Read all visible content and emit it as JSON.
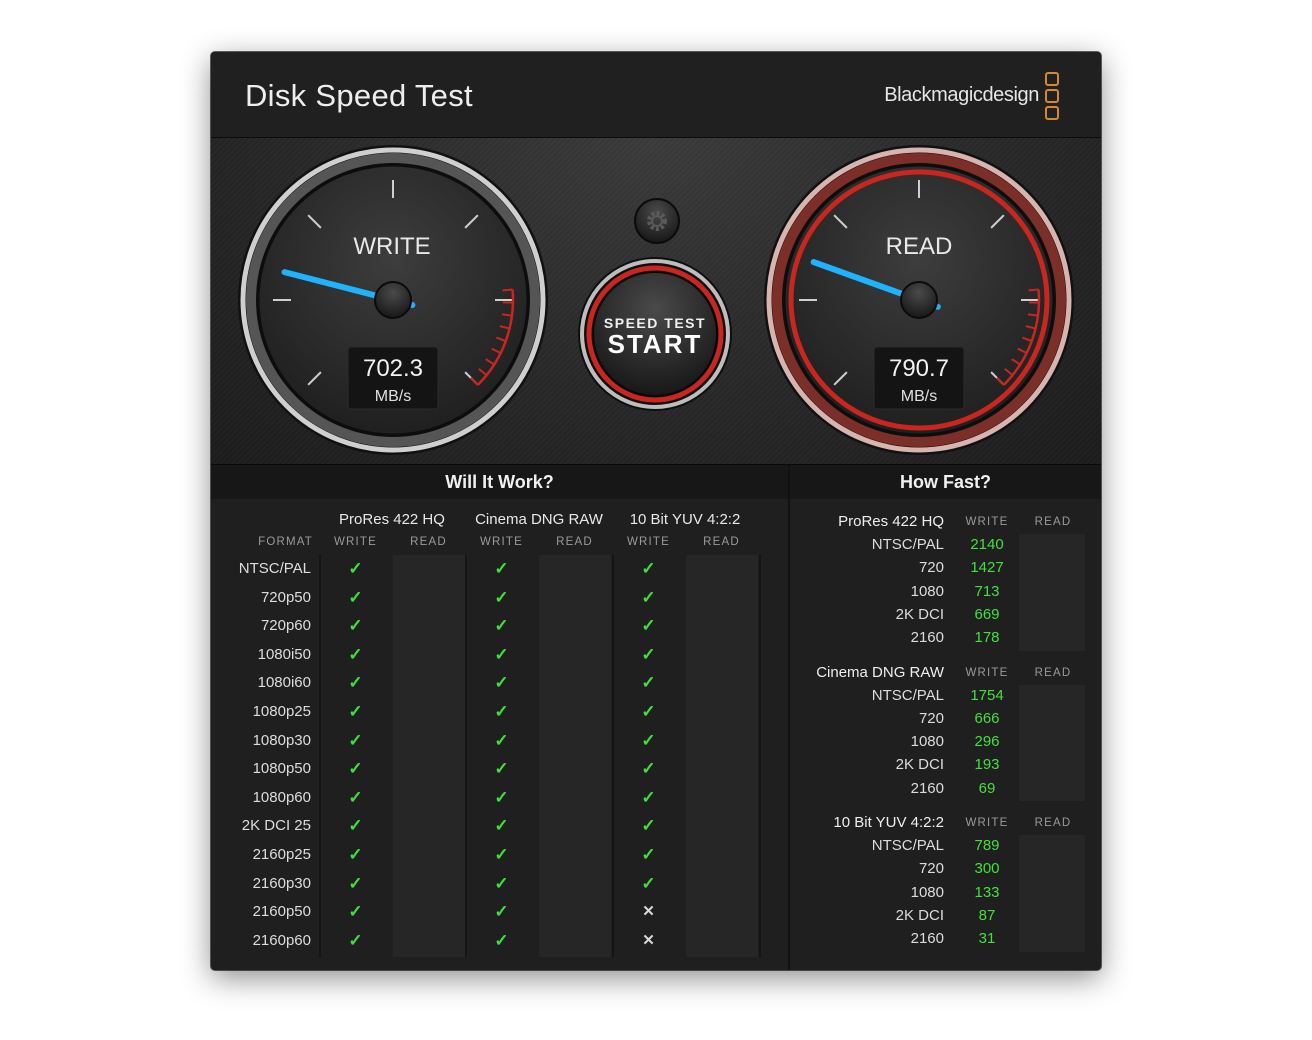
{
  "window": {
    "title": "Disk Speed Test",
    "brand": "Blackmagicdesign",
    "close_glyph": "×"
  },
  "gauges": {
    "write": {
      "label": "WRITE",
      "value": "702.3",
      "unit": "MB/s",
      "needle_fraction": 0.22
    },
    "read": {
      "label": "READ",
      "value": "790.7",
      "unit": "MB/s",
      "needle_fraction": 0.24
    }
  },
  "start_button": {
    "line1": "SPEED TEST",
    "line2": "START"
  },
  "settings_icon": "gear-icon",
  "colors": {
    "accent_red": "#c8261e",
    "needle_blue": "#1fb3ff",
    "ok_green": "#3fe03a",
    "brand_orange": "#d48a2a"
  },
  "will_it_work": {
    "title": "Will It Work?",
    "format_label": "FORMAT",
    "write_label": "WRITE",
    "read_label": "READ",
    "codecs": [
      "ProRes 422 HQ",
      "Cinema DNG RAW",
      "10 Bit YUV 4:2:2"
    ],
    "rows": [
      {
        "format": "NTSC/PAL",
        "write": [
          "ok",
          "ok",
          "ok"
        ]
      },
      {
        "format": "720p50",
        "write": [
          "ok",
          "ok",
          "ok"
        ]
      },
      {
        "format": "720p60",
        "write": [
          "ok",
          "ok",
          "ok"
        ]
      },
      {
        "format": "1080i50",
        "write": [
          "ok",
          "ok",
          "ok"
        ]
      },
      {
        "format": "1080i60",
        "write": [
          "ok",
          "ok",
          "ok"
        ]
      },
      {
        "format": "1080p25",
        "write": [
          "ok",
          "ok",
          "ok"
        ]
      },
      {
        "format": "1080p30",
        "write": [
          "ok",
          "ok",
          "ok"
        ]
      },
      {
        "format": "1080p50",
        "write": [
          "ok",
          "ok",
          "ok"
        ]
      },
      {
        "format": "1080p60",
        "write": [
          "ok",
          "ok",
          "ok"
        ]
      },
      {
        "format": "2K DCI 25",
        "write": [
          "ok",
          "ok",
          "ok"
        ]
      },
      {
        "format": "2160p25",
        "write": [
          "ok",
          "ok",
          "ok"
        ]
      },
      {
        "format": "2160p30",
        "write": [
          "ok",
          "ok",
          "ok"
        ]
      },
      {
        "format": "2160p50",
        "write": [
          "ok",
          "ok",
          "no"
        ]
      },
      {
        "format": "2160p60",
        "write": [
          "ok",
          "ok",
          "no"
        ]
      }
    ],
    "ok_glyph": "✓",
    "no_glyph": "✕"
  },
  "how_fast": {
    "title": "How Fast?",
    "write_label": "WRITE",
    "read_label": "READ",
    "groups": [
      {
        "codec": "ProRes 422 HQ",
        "rows": [
          {
            "label": "NTSC/PAL",
            "write": "2140"
          },
          {
            "label": "720",
            "write": "1427"
          },
          {
            "label": "1080",
            "write": "713"
          },
          {
            "label": "2K DCI",
            "write": "669"
          },
          {
            "label": "2160",
            "write": "178"
          }
        ]
      },
      {
        "codec": "Cinema DNG RAW",
        "rows": [
          {
            "label": "NTSC/PAL",
            "write": "1754"
          },
          {
            "label": "720",
            "write": "666"
          },
          {
            "label": "1080",
            "write": "296"
          },
          {
            "label": "2K DCI",
            "write": "193"
          },
          {
            "label": "2160",
            "write": "69"
          }
        ]
      },
      {
        "codec": "10 Bit YUV 4:2:2",
        "rows": [
          {
            "label": "NTSC/PAL",
            "write": "789"
          },
          {
            "label": "720",
            "write": "300"
          },
          {
            "label": "1080",
            "write": "133"
          },
          {
            "label": "2K DCI",
            "write": "87"
          },
          {
            "label": "2160",
            "write": "31"
          }
        ]
      }
    ]
  }
}
